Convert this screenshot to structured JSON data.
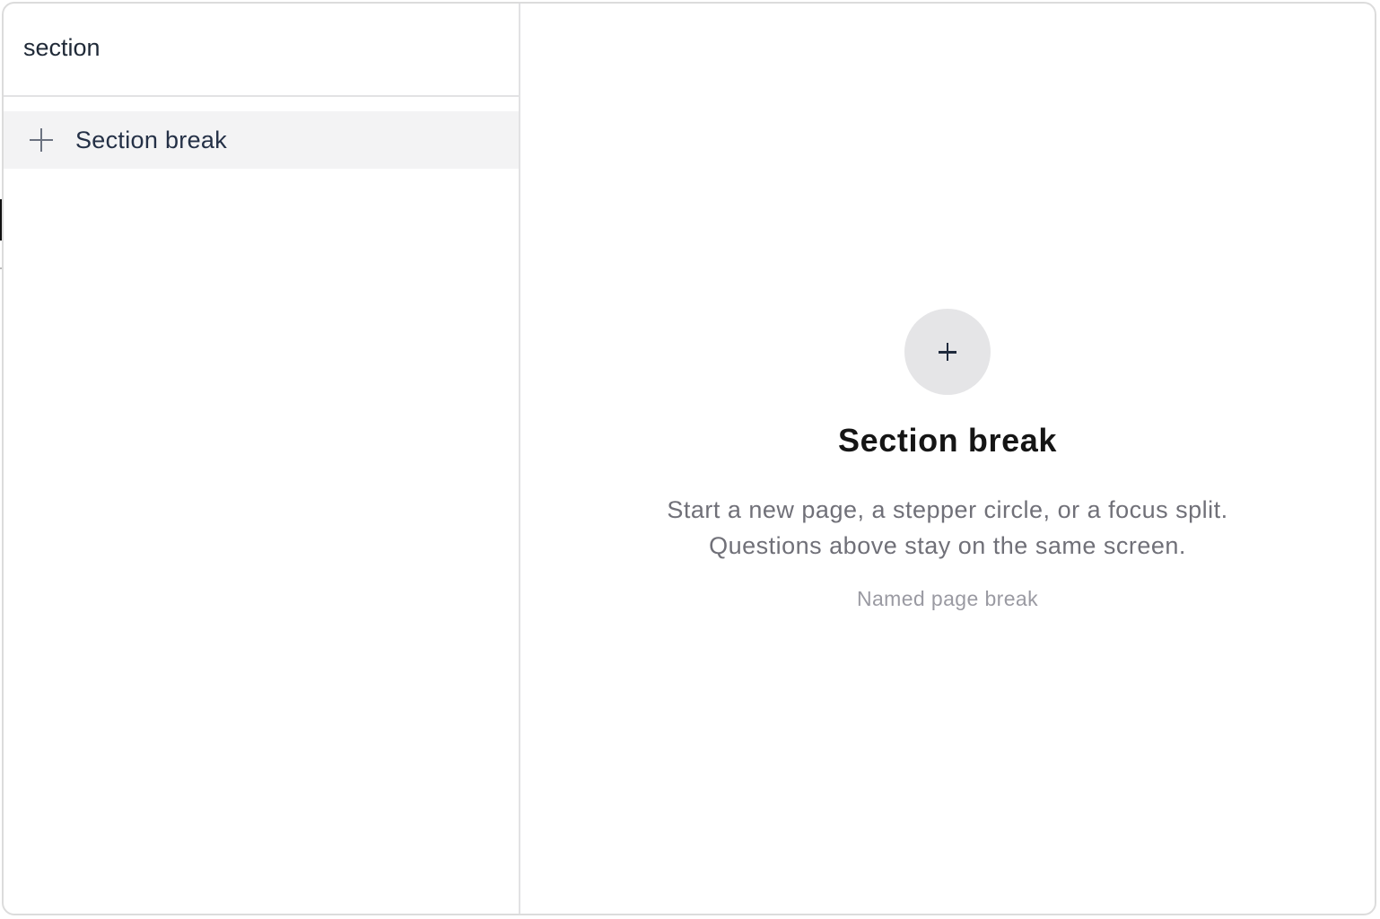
{
  "search": {
    "value": "section"
  },
  "results": [
    {
      "label": "Section break",
      "icon": "plus-icon"
    }
  ],
  "preview": {
    "icon": "plus-icon",
    "title": "Section break",
    "description_line1": "Start a new page, a stepper circle, or a focus split.",
    "description_line2": "Questions above stay on the same screen.",
    "hint": "Named page break"
  },
  "colors": {
    "selected_row_bg": "#f3f3f4",
    "divider": "#e2e2e4",
    "preview_circle_bg": "#e5e5e7"
  }
}
